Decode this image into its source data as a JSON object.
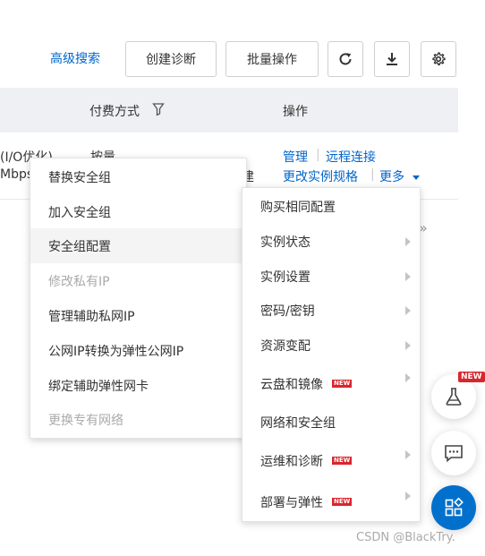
{
  "toolbar": {
    "advanced_search": "高级搜索",
    "create_diagnosis": "创建诊断",
    "batch_ops": "批量操作",
    "refresh_icon": "refresh-icon",
    "download_icon": "download-icon",
    "settings_icon": "gear-icon"
  },
  "table": {
    "headers": {
      "payment": "付费方式",
      "actions": "操作"
    },
    "row": {
      "net_line1": "(I/O优化)",
      "net_line2": "Mbps",
      "payment_value": "按量",
      "trailing_fragment": "建",
      "action_manage": "管理",
      "action_remote": "远程连接",
      "action_resize": "更改实例规格",
      "action_more": "更多"
    }
  },
  "menu_left": {
    "items": [
      {
        "label": "替换安全组",
        "disabled": false
      },
      {
        "label": "加入安全组",
        "disabled": false
      },
      {
        "label": "安全组配置",
        "disabled": false,
        "hover": true
      },
      {
        "label": "修改私有IP",
        "disabled": true
      },
      {
        "label": "管理辅助私网IP",
        "disabled": false
      },
      {
        "label": "公网IP转换为弹性公网IP",
        "disabled": false
      },
      {
        "label": "绑定辅助弹性网卡",
        "disabled": false
      },
      {
        "label": "更换专有网络",
        "disabled": true
      }
    ]
  },
  "menu_right": {
    "new_badge": "NEW",
    "items": [
      {
        "label": "购买相同配置",
        "arrow": false,
        "new": false
      },
      {
        "label": "实例状态",
        "arrow": true,
        "new": false
      },
      {
        "label": "实例设置",
        "arrow": true,
        "new": false
      },
      {
        "label": "密码/密钥",
        "arrow": true,
        "new": false
      },
      {
        "label": "资源变配",
        "arrow": true,
        "new": false
      },
      {
        "label": "云盘和镜像",
        "arrow": true,
        "new": true
      },
      {
        "label": "网络和安全组",
        "arrow": false,
        "new": false
      },
      {
        "label": "运维和诊断",
        "arrow": true,
        "new": true
      },
      {
        "label": "部署与弹性",
        "arrow": true,
        "new": true
      }
    ]
  },
  "floating": {
    "new_badge": "NEW",
    "lab_icon": "flask-icon",
    "chat_icon": "chat-icon",
    "apps_icon": "apps-icon"
  },
  "pagination_chevron": "»",
  "watermark": "CSDN @BlackTry."
}
